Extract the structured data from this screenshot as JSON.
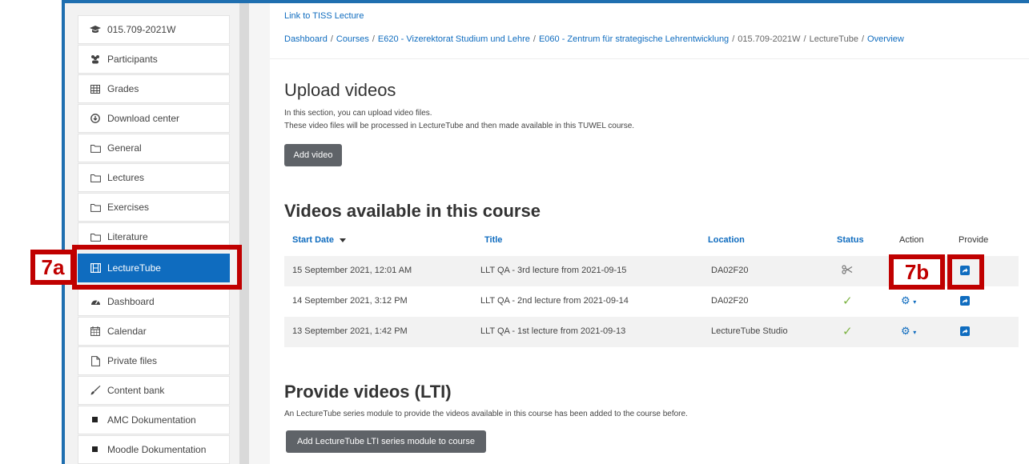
{
  "sidebar": {
    "items": [
      {
        "label": "015.709-2021W",
        "icon": "graduation-cap-icon"
      },
      {
        "label": "Participants",
        "icon": "users-icon"
      },
      {
        "label": "Grades",
        "icon": "table-icon"
      },
      {
        "label": "Download center",
        "icon": "download-circle-icon"
      },
      {
        "label": "General",
        "icon": "folder-icon"
      },
      {
        "label": "Lectures",
        "icon": "folder-icon"
      },
      {
        "label": "Exercises",
        "icon": "folder-icon"
      },
      {
        "label": "Literature",
        "icon": "folder-icon"
      },
      {
        "label": "LectureTube",
        "icon": "film-icon"
      },
      {
        "label": "Dashboard",
        "icon": "dashboard-icon"
      },
      {
        "label": "Calendar",
        "icon": "calendar-icon"
      },
      {
        "label": "Private files",
        "icon": "file-icon"
      },
      {
        "label": "Content bank",
        "icon": "brush-icon"
      },
      {
        "label": "AMC Dokumentation",
        "icon": "square-bullet-icon"
      },
      {
        "label": "Moodle Dokumentation",
        "icon": "square-bullet-icon"
      }
    ],
    "active_index": 8
  },
  "header": {
    "tiss_link": "Link to TISS Lecture",
    "breadcrumb": [
      "Dashboard",
      "Courses",
      "E620 - Vizerektorat Studium und Lehre",
      "E060 - Zentrum für strategische Lehrentwicklung",
      "015.709-2021W",
      "LectureTube",
      "Overview"
    ]
  },
  "upload": {
    "title": "Upload videos",
    "line1": "In this section, you can upload video files.",
    "line2": "These video files will be processed in LectureTube and then made available in this TUWEL course.",
    "button": "Add video"
  },
  "videos": {
    "title": "Videos available in this course",
    "columns": [
      "Start Date",
      "Title",
      "Location",
      "Status",
      "Action",
      "Provide"
    ],
    "rows": [
      {
        "date": "15 September 2021, 12:01 AM",
        "title": "LLT QA - 3rd lecture from 2021-09-15",
        "location": "DA02F20",
        "status": "processing"
      },
      {
        "date": "14 September 2021, 3:12 PM",
        "title": "LLT QA - 2nd lecture from 2021-09-14",
        "location": "DA02F20",
        "status": "done"
      },
      {
        "date": "13 September 2021, 1:42 PM",
        "title": "LLT QA - 1st lecture from 2021-09-13",
        "location": "LectureTube Studio",
        "status": "done"
      }
    ]
  },
  "provide": {
    "title": "Provide videos (LTI)",
    "line": "An LectureTube series module to provide the videos available in this course has been added to the course before.",
    "button": "Add LectureTube LTI series module to course"
  },
  "annotations": {
    "a": "7a",
    "b": "7b",
    "color": "#c00000"
  },
  "colors": {
    "accent": "#0f6cbf",
    "success": "#7cb342"
  }
}
